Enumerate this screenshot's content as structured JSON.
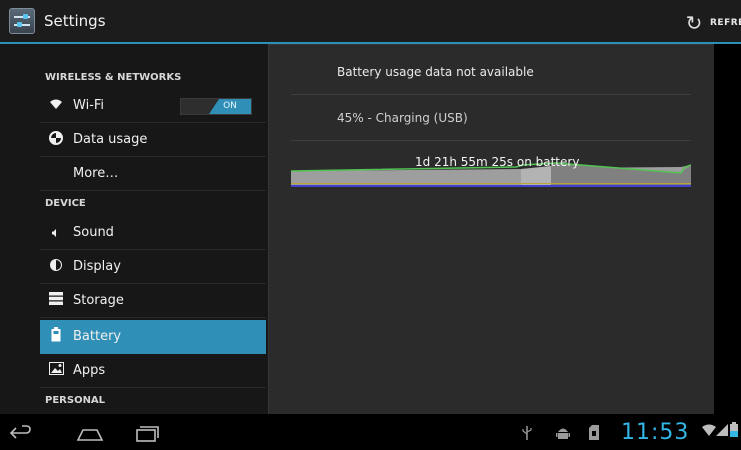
{
  "header": {
    "title": "Settings",
    "refresh_label": "REFRESH",
    "app_icon": "settings-sliders-icon",
    "refresh_icon": "refresh-icon"
  },
  "sidebar": {
    "sections": [
      {
        "label": "WIRELESS & NETWORKS"
      },
      {
        "label": "DEVICE"
      },
      {
        "label": "PERSONAL"
      }
    ],
    "items": [
      {
        "label": "Wi-Fi",
        "icon": "wifi-icon",
        "toggle": "ON"
      },
      {
        "label": "Data usage",
        "icon": "data-usage-icon"
      },
      {
        "label": "More…",
        "icon": ""
      },
      {
        "label": "Sound",
        "icon": "speaker-icon"
      },
      {
        "label": "Display",
        "icon": "display-icon"
      },
      {
        "label": "Storage",
        "icon": "storage-icon"
      },
      {
        "label": "Battery",
        "icon": "battery-icon",
        "selected": true
      },
      {
        "label": "Apps",
        "icon": "apps-icon"
      }
    ]
  },
  "battery": {
    "message": "Battery usage data not available",
    "status": "45% - Charging (USB)",
    "graph_label": "1d 21h 55m 25s on battery"
  },
  "navbar": {
    "back": "back-icon",
    "home": "home-icon",
    "recents": "recent-apps-icon"
  },
  "statusbar": {
    "time": "11:53",
    "icons": [
      "usb-icon",
      "android-debug-icon",
      "sd-card-icon",
      "wifi-signal-icon",
      "cell-signal-icon",
      "battery-charging-icon"
    ]
  },
  "colors": {
    "accent": "#33b5e5",
    "selection": "#2f8fb6"
  }
}
